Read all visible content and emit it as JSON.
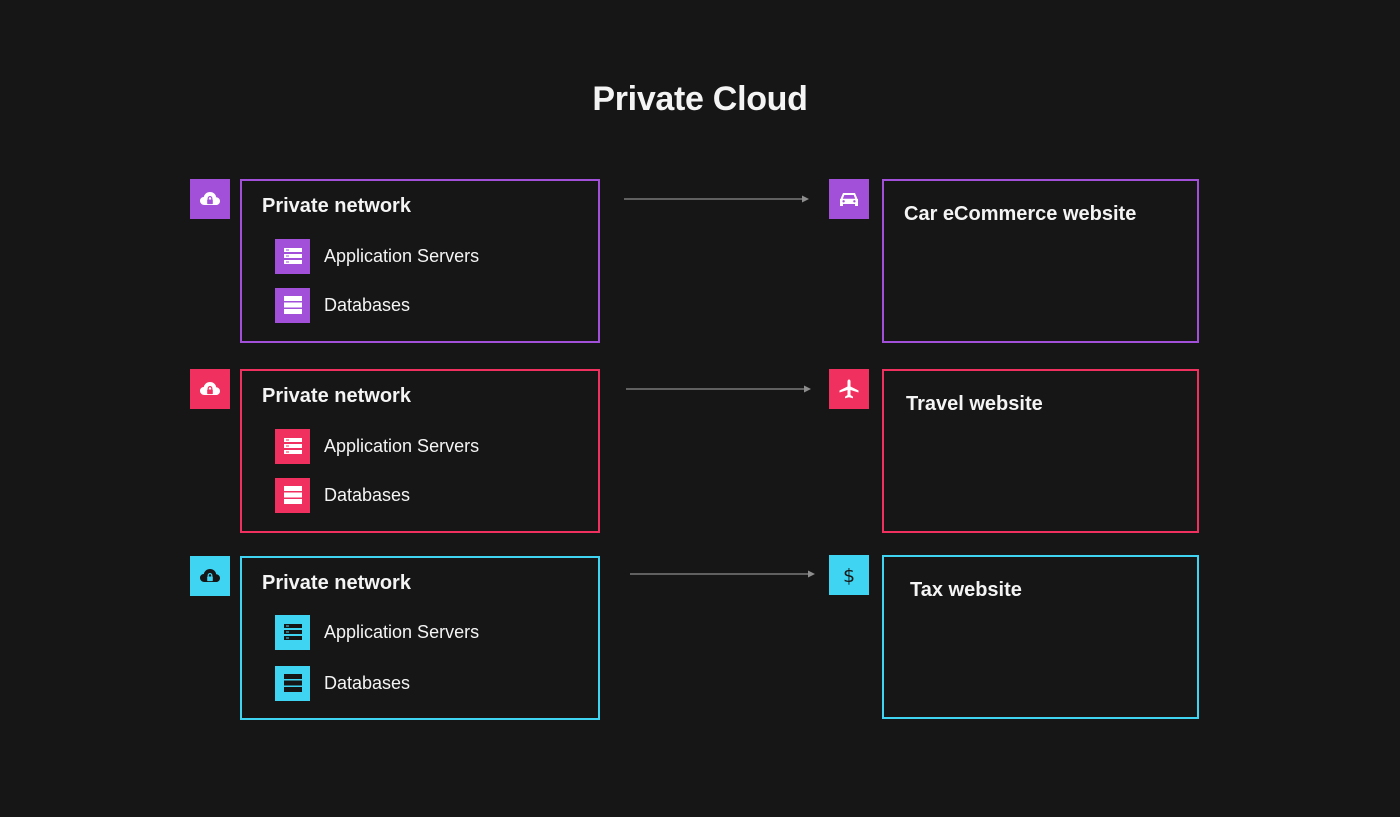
{
  "title": "Private Cloud",
  "colors": {
    "background": "#161616",
    "purple": "#a24fd9",
    "red": "#f0305e",
    "cyan": "#3fd5f2",
    "arrow": "#8d8d8d"
  },
  "rows": [
    {
      "network": {
        "title": "Private network",
        "icon": "cloud-lock-icon",
        "items": [
          {
            "label": "Application Servers",
            "icon": "server-rack-icon"
          },
          {
            "label": "Databases",
            "icon": "database-icon"
          }
        ]
      },
      "site": {
        "title": "Car eCommerce website",
        "icon": "car-icon"
      }
    },
    {
      "network": {
        "title": "Private network",
        "icon": "cloud-lock-icon",
        "items": [
          {
            "label": "Application Servers",
            "icon": "server-rack-icon"
          },
          {
            "label": "Databases",
            "icon": "database-icon"
          }
        ]
      },
      "site": {
        "title": "Travel website",
        "icon": "airplane-icon"
      }
    },
    {
      "network": {
        "title": "Private network",
        "icon": "cloud-lock-icon",
        "items": [
          {
            "label": "Application Servers",
            "icon": "server-rack-icon"
          },
          {
            "label": "Databases",
            "icon": "database-icon"
          }
        ]
      },
      "site": {
        "title": "Tax website",
        "icon": "dollar-icon"
      }
    }
  ]
}
